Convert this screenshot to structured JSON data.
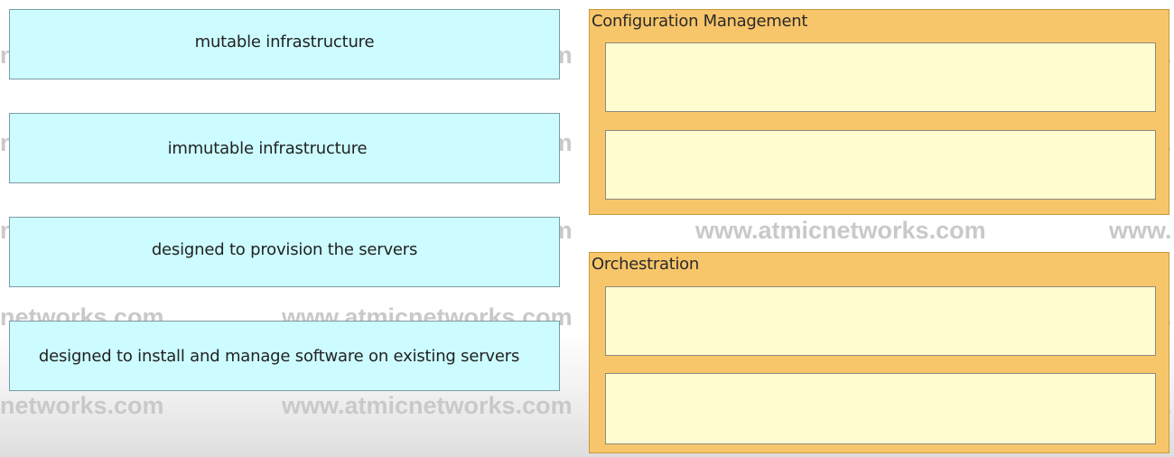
{
  "watermark": {
    "left_fragment": "networks.com",
    "full": "www.atmicnetworks.com",
    "right_fragment": "www."
  },
  "source_items": [
    {
      "label": "mutable infrastructure"
    },
    {
      "label": "immutable infrastructure"
    },
    {
      "label": "designed to provision the servers"
    },
    {
      "label": "designed to install and manage software on existing servers"
    }
  ],
  "target_groups": [
    {
      "title": "Configuration Management"
    },
    {
      "title": "Orchestration"
    }
  ],
  "colors": {
    "source_item_bg": "#ccfcff",
    "target_group_bg": "#f8c66a",
    "drop_slot_bg": "#fffcd0",
    "watermark": "#c9c9c9"
  }
}
